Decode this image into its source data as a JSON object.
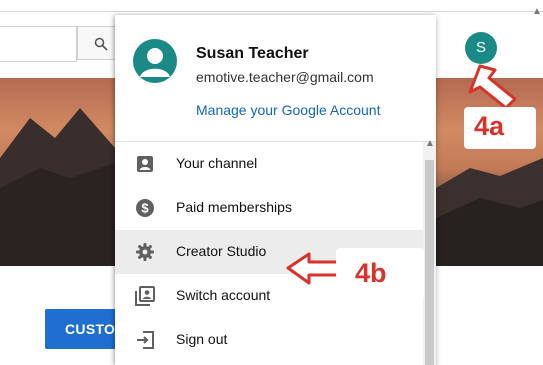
{
  "search": {
    "placeholder": ""
  },
  "banner": {
    "customize_label": "CUSTO"
  },
  "account": {
    "avatar_letter": "S",
    "name": "Susan Teacher",
    "email": "emotive.teacher@gmail.com",
    "manage_label": "Manage your Google Account"
  },
  "menu": {
    "items": [
      {
        "label": "Your channel",
        "icon": "account-box-icon"
      },
      {
        "label": "Paid memberships",
        "icon": "dollar-circle-icon"
      },
      {
        "label": "Creator Studio",
        "icon": "gear-icon"
      },
      {
        "label": "Switch account",
        "icon": "switch-account-icon"
      },
      {
        "label": "Sign out",
        "icon": "sign-out-icon"
      }
    ]
  },
  "annotations": {
    "step_a": "4a",
    "step_b": "4b"
  },
  "colors": {
    "annotation": "#d8332a",
    "avatar": "#1b8a86",
    "link": "#1565c0",
    "primary_button": "#1f6fd1"
  }
}
